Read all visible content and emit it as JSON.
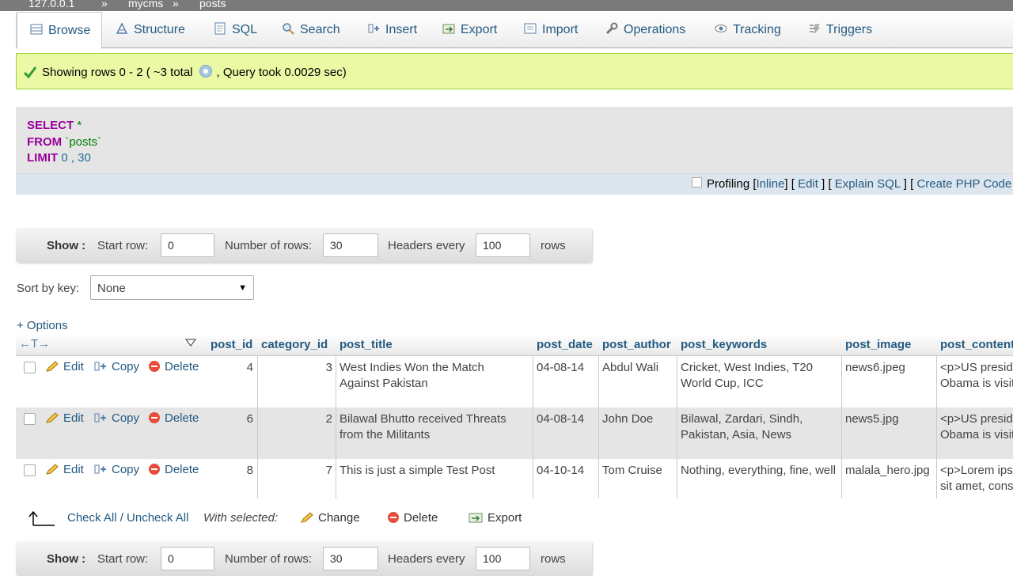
{
  "breadcrumb": {
    "server": "127.0.0.1",
    "sep": "»",
    "database": "mycms",
    "table": "posts"
  },
  "tabs": [
    {
      "label": "Browse"
    },
    {
      "label": "Structure"
    },
    {
      "label": "SQL"
    },
    {
      "label": "Search"
    },
    {
      "label": "Insert"
    },
    {
      "label": "Export"
    },
    {
      "label": "Import"
    },
    {
      "label": "Operations"
    },
    {
      "label": "Tracking"
    },
    {
      "label": "Triggers"
    }
  ],
  "success": {
    "part1": "Showing rows 0 - 2 ( ~3 total",
    "part2": ", Query took 0.0029 sec)"
  },
  "sql": {
    "select": "SELECT",
    "star": " *",
    "from": "FROM",
    "table": " `posts`",
    "limit": "LIMIT",
    "limit_vals": " 0 , 30"
  },
  "sql_links": {
    "profiling": "Profiling",
    "inline": "Inline",
    "edit": "Edit",
    "explain": "Explain SQL",
    "create_php": "Create PHP Code"
  },
  "nav": {
    "show": "Show :",
    "start_row": "Start row:",
    "start_value": "0",
    "num_rows": "Number of rows:",
    "num_value": "30",
    "headers_every": "Headers every",
    "headers_value": "100",
    "rows": "rows"
  },
  "sort": {
    "label": "Sort by key:",
    "selected": "None"
  },
  "options_link": "+ Options",
  "table": {
    "arrows": "←T→",
    "columns": [
      "post_id",
      "category_id",
      "post_title",
      "post_date",
      "post_author",
      "post_keywords",
      "post_image",
      "post_content"
    ],
    "action_labels": {
      "edit": "Edit",
      "copy": "Copy",
      "delete": "Delete"
    },
    "rows": [
      {
        "post_id": "4",
        "category_id": "3",
        "post_title": "West Indies Won the Match Against Pakistan",
        "post_date": "04-08-14",
        "post_author": "Abdul Wali",
        "post_keywords": "Cricket, West Indies, T20 World Cup, ICC",
        "post_image": "news6.jpeg",
        "post_content": "<p>US president Obama is visiting ki..."
      },
      {
        "post_id": "6",
        "category_id": "2",
        "post_title": "Bilawal Bhutto received Threats from the Militants",
        "post_date": "04-08-14",
        "post_author": "John Doe",
        "post_keywords": "Bilawal, Zardari, Sindh, Pakistan, Asia, News",
        "post_image": "news5.jpg",
        "post_content": "<p>US president Obama is visiting ki..."
      },
      {
        "post_id": "8",
        "category_id": "7",
        "post_title": "This is just a simple Test Post",
        "post_date": "04-10-14",
        "post_author": "Tom Cruise",
        "post_keywords": "Nothing, everything, fine, well",
        "post_image": "malala_hero.jpg",
        "post_content": "<p>Lorem ipsum dolor sit amet, consectetur..."
      }
    ]
  },
  "bottom": {
    "check_all": "Check All / Uncheck All",
    "with_selected": "With selected:",
    "change": "Change",
    "delete": "Delete",
    "export": "Export"
  },
  "colors": {
    "link": "#235a81",
    "success_bg": "#ebf8a4",
    "sql_bg": "#e5e5e5",
    "keyword": "#990099"
  }
}
